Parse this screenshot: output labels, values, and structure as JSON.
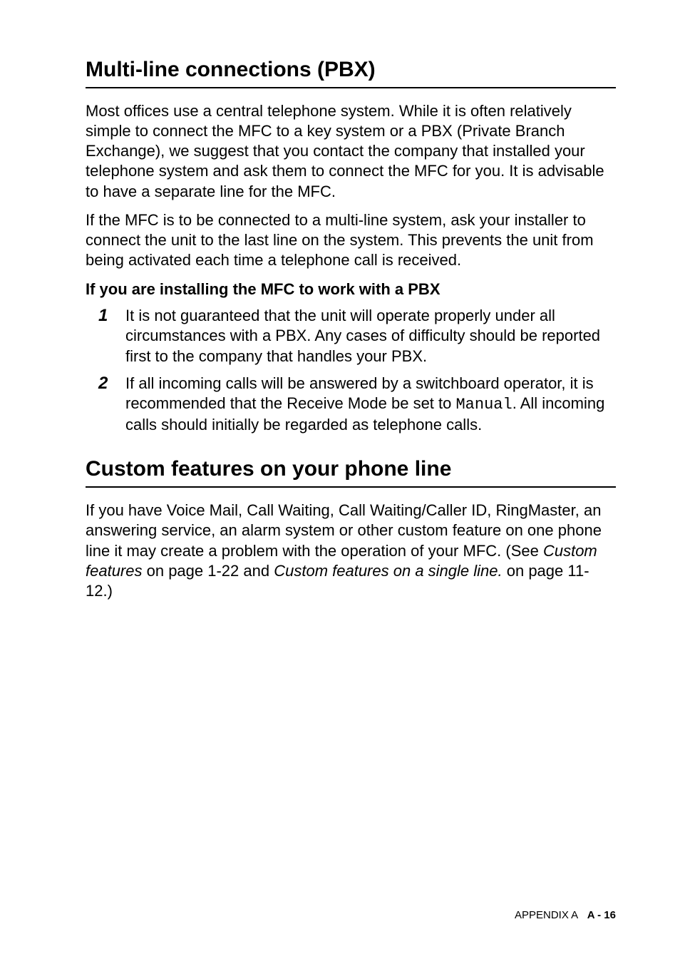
{
  "section1": {
    "heading": "Multi-line connections (PBX)",
    "para1": "Most offices use a central telephone system. While it is often relatively simple to connect the MFC to a key system or a PBX (Private Branch Exchange), we suggest that you contact the company that installed your telephone system and ask them to connect the MFC for you. It is advisable to have a separate line for the MFC.",
    "para2": "If the MFC is to be connected to a multi-line system, ask your installer to connect the unit to the last line on the system. This prevents the unit from being activated each time a telephone call is received.",
    "subheading": "If you are installing the MFC to work with a PBX",
    "item1_num": "1",
    "item1_text": "It is not guaranteed that the unit will operate properly under all circumstances with a PBX. Any cases of difficulty should be reported first to the company that handles your PBX.",
    "item2_num": "2",
    "item2_text_a": "If all incoming calls will be answered by a switchboard operator, it is recommended that the Receive Mode be set to ",
    "item2_mono": "Manual",
    "item2_text_b": ". All incoming calls should initially be regarded as telephone calls."
  },
  "section2": {
    "heading": "Custom features on your phone line",
    "para_a": "If you have Voice Mail, Call Waiting, Call Waiting/Caller ID, RingMaster, an answering service, an alarm system or other custom feature on one phone line it may create a problem with the operation of your MFC. (See ",
    "para_ital1": "Custom features",
    "para_b": " on page 1-22 and ",
    "para_ital2": "Custom features on a single line.",
    "para_c": " on page 11-12.)"
  },
  "footer": {
    "left": "APPENDIX A",
    "right": "A - 16"
  }
}
